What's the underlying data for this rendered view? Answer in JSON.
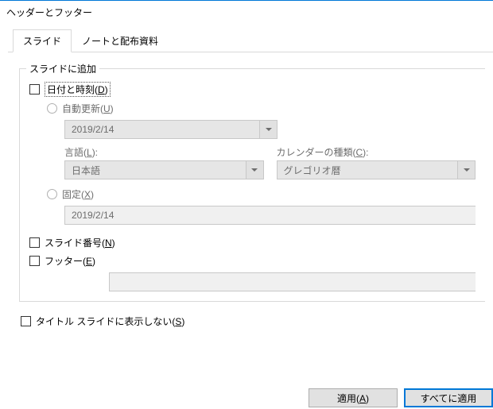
{
  "window": {
    "title": "ヘッダーとフッター"
  },
  "tabs": {
    "slide": "スライド",
    "notes": "ノートと配布資料"
  },
  "group": {
    "title": "スライドに追加",
    "datetime": {
      "label_pre": "日付と時刻(",
      "label_key": "D",
      "label_post": ")",
      "auto": {
        "label_pre": "自動更新(",
        "label_key": "U",
        "label_post": ")",
        "date_value": "2019/2/14",
        "lang_label_pre": "言語(",
        "lang_label_key": "L",
        "lang_label_post": "):",
        "lang_value": "日本語",
        "cal_label_pre": "カレンダーの種類(",
        "cal_label_key": "C",
        "cal_label_post": "):",
        "cal_value": "グレゴリオ暦"
      },
      "fixed": {
        "label_pre": "固定(",
        "label_key": "X",
        "label_post": ")",
        "value": "2019/2/14"
      }
    },
    "slidenum": {
      "label_pre": "スライド番号(",
      "label_key": "N",
      "label_post": ")"
    },
    "footer": {
      "label_pre": "フッター(",
      "label_key": "E",
      "label_post": ")",
      "value": ""
    }
  },
  "hide_title": {
    "label_pre": "タイトル スライドに表示しない(",
    "label_key": "S",
    "label_post": ")"
  },
  "buttons": {
    "apply_pre": "適用(",
    "apply_key": "A",
    "apply_post": ")",
    "apply_all": "すべてに適用"
  }
}
